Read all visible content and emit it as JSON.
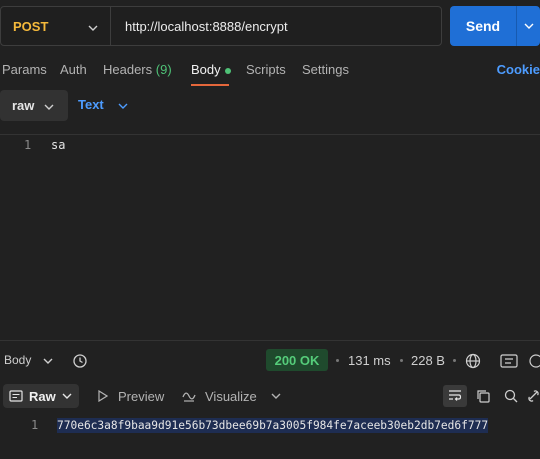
{
  "request": {
    "method": "POST",
    "url": "http://localhost:8888/encrypt",
    "send_label": "Send"
  },
  "tabs": [
    {
      "label": "Params"
    },
    {
      "label": "Auth"
    },
    {
      "label": "Headers",
      "count": "(9)"
    },
    {
      "label": "Body"
    },
    {
      "label": "Scripts"
    },
    {
      "label": "Settings"
    }
  ],
  "cookies_label": "Cookie",
  "body_editor": {
    "mode": "raw",
    "format": "Text",
    "lines": [
      {
        "num": "1",
        "text": "sa"
      }
    ]
  },
  "response": {
    "tab_label": "Body",
    "status": "200 OK",
    "time": "131 ms",
    "size": "228 B",
    "view_mode": "Raw",
    "preview_label": "Preview",
    "visualize_label": "Visualize",
    "lines": [
      {
        "num": "1",
        "text": "770e6c3a8f9baa9d91e56b73dbee69b7a3005f984fe7aceeb30eb2db7ed6f777"
      }
    ]
  },
  "colors": {
    "method": "#f5b93b",
    "send": "#1f6fd6",
    "status_ok": "#55cc7a",
    "active_tab_underline": "#e5673b",
    "link": "#4d9cff"
  }
}
